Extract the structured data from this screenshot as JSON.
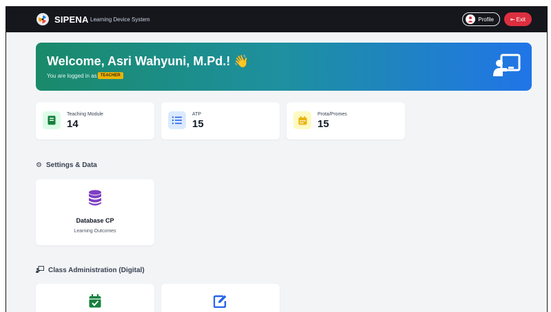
{
  "navbar": {
    "brand_name": "SIPENA",
    "brand_subtitle": "Learning Device System",
    "profile_label": "Profile",
    "exit_label": "Exit"
  },
  "welcome": {
    "title": "Welcome, Asri Wahyuni, M.Pd.! 👋",
    "logged_in_text": "You are logged in as",
    "role": "TEACHER"
  },
  "stats": [
    {
      "label": "Teaching Module",
      "value": "14",
      "icon": "book-icon",
      "color": "#15803d"
    },
    {
      "label": "ATP",
      "value": "15",
      "icon": "list-ordered-icon",
      "color": "#2563eb"
    },
    {
      "label": "Prota/Promes",
      "value": "15",
      "icon": "calendar-icon",
      "color": "#eab308"
    }
  ],
  "sections": {
    "settings_title": "Settings & Data",
    "class_admin_title": "Class Administration (Digital)"
  },
  "menu": {
    "database_cp": {
      "title": "Database CP",
      "subtitle": "Learning Outcomes",
      "icon": "database-icon",
      "color": "#7e3fc4"
    },
    "attendance": {
      "icon": "calendar-check-icon",
      "color": "#15803d"
    },
    "journal": {
      "icon": "edit-icon",
      "color": "#2563eb"
    }
  },
  "colors": {
    "navbar": "#16161d",
    "exit_button": "#dc2f3f",
    "banner_start": "#1a8a6a",
    "banner_end": "#2075e8",
    "role_badge": "#eab308"
  }
}
